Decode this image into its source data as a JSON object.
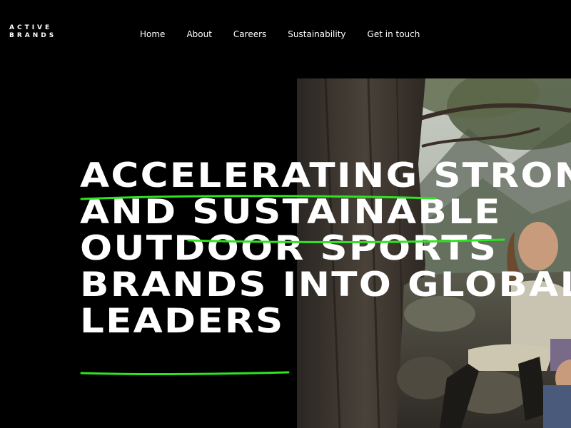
{
  "header": {
    "logo_line1": "ACTIVE",
    "logo_line2": "BRANDS"
  },
  "nav": {
    "items": [
      {
        "label": "Home"
      },
      {
        "label": "About"
      },
      {
        "label": "Careers"
      },
      {
        "label": "Sustainability"
      },
      {
        "label": "Get in touch"
      }
    ]
  },
  "hero": {
    "headline_lines": [
      "ACCELERATING STRONG",
      "AND SUSTAINABLE",
      "OUTDOOR SPORTS",
      "BRANDS INTO GLOBAL",
      "LEADERS"
    ],
    "image_alt": "Two women in outdoor clothing sitting on mossy rocks beneath a large pine tree in the mountains"
  },
  "colors": {
    "background": "#000000",
    "text": "#ffffff",
    "accent": "#2ee31f"
  }
}
